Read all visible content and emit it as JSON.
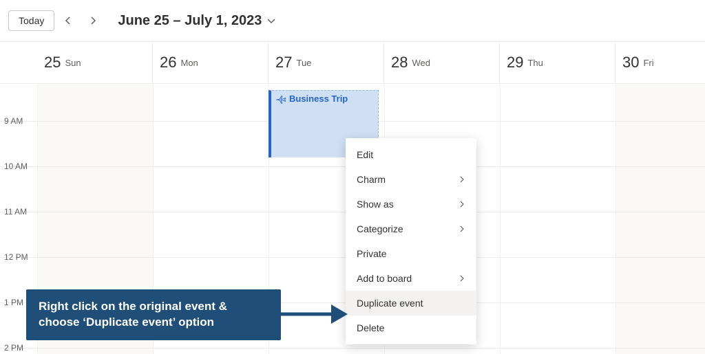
{
  "toolbar": {
    "today_label": "Today",
    "date_range": "June 25 – July 1, 2023"
  },
  "days": [
    {
      "num": "25",
      "wk": "Sun"
    },
    {
      "num": "26",
      "wk": "Mon"
    },
    {
      "num": "27",
      "wk": "Tue"
    },
    {
      "num": "28",
      "wk": "Wed"
    },
    {
      "num": "29",
      "wk": "Thu"
    },
    {
      "num": "30",
      "wk": "Fri"
    }
  ],
  "hours": [
    "9 AM",
    "10 AM",
    "11 AM",
    "12 PM",
    "1 PM",
    "2 PM"
  ],
  "event": {
    "title": "Business Trip",
    "icon": "plane-icon"
  },
  "context_menu": {
    "items": [
      {
        "label": "Edit",
        "submenu": false
      },
      {
        "label": "Charm",
        "submenu": true
      },
      {
        "label": "Show as",
        "submenu": true
      },
      {
        "label": "Categorize",
        "submenu": true
      },
      {
        "label": "Private",
        "submenu": false
      },
      {
        "label": "Add to board",
        "submenu": true
      },
      {
        "label": "Duplicate event",
        "submenu": false,
        "highlight": true
      },
      {
        "label": "Delete",
        "submenu": false
      }
    ]
  },
  "annotation": {
    "text": "Right click on the original event & choose ‘Duplicate event’ option"
  }
}
